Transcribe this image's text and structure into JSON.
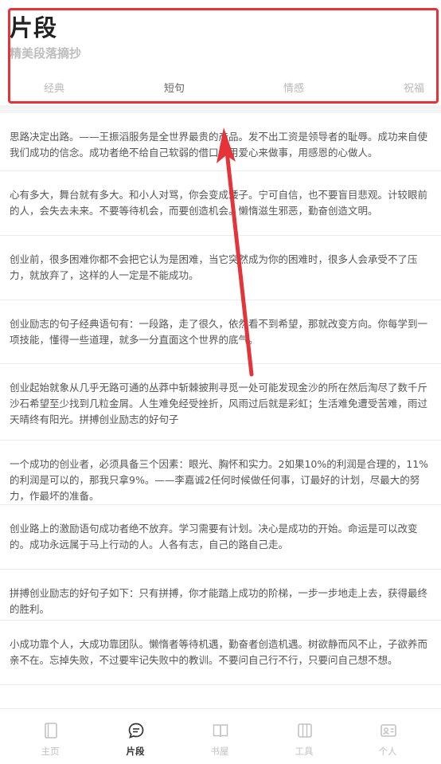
{
  "header": {
    "title": "片段",
    "subtitle": "精美段落摘抄",
    "tabs": [
      {
        "label": "经典"
      },
      {
        "label": "短句"
      },
      {
        "label": "情感"
      },
      {
        "label": "祝福"
      }
    ],
    "highlight_color": "#e5333a"
  },
  "list": {
    "items": [
      {
        "text": "思路决定出路。——王振滔服务是全世界最贵的产品。发不出工资是领导者的耻辱。成功来自使我们成功的信念。成功者绝不给自己软弱的借口。用爱心来做事，用感恩的心做人。"
      },
      {
        "text": "心有多大，舞台就有多大。和小人对骂，你会变成矮子。宁可自信，也不要盲目悲观。计较眼前的人，会失去未来。不要等待机会，而要创造机会。懒惰滋生邪恶，勤奋创造文明。"
      },
      {
        "text": "创业前，很多困难你都不会把它认为是困难，当它突然成为你的困难时，很多人会承受不了压力，就放弃了，这样的人一定是不能成功。"
      },
      {
        "text": "创业励志的句子经典语句有：一段路，走了很久，依然看不到希望，那就改变方向。你每学到一项技能，懂得一些道理，就多一分直面这个世界的底气。"
      },
      {
        "text": "创业起始就象从几乎无路可通的丛莽中斩棘披荆寻觅一处可能发现金沙的所在然后淘尽了数千斤沙石希望至少找到几粒金屑。人生难免经受挫折，风雨过后就是彩虹；生活难免遭受苦难，雨过天晴终有阳光。拼搏创业励志的好句子"
      },
      {
        "text": "一个成功的创业者，必须具备三个因素：眼光、胸怀和实力。2如果10%的利润是合理的，11%的利润是可以的，那我只拿9%。——李嘉诚2任何时候做任何事，订最好的计划，尽最大的努力，作最坏的准备。"
      },
      {
        "text": "创业路上的激励语句成功者绝不放弃。学习需要有计划。决心是成功的开始。命运是可以改变的。成功永远属于马上行动的人。人各有志，自己的路自己走。"
      },
      {
        "text": "拼搏创业励志的好句子如下：只有拼搏，你才能踏上成功的阶梯，一步一步地走上去，获得最终的胜利。"
      },
      {
        "text": "小成功靠个人，大成功靠团队。懒惰者等待机遇，勤奋者创造机遇。树欲静而风不止，子欲养而亲不在。忘掉失败，不过要牢记失败中的教训。不要问自己行不行，只要问自己想不想。"
      }
    ]
  },
  "nav": {
    "items": [
      {
        "label": "主页",
        "icon": "book-icon"
      },
      {
        "label": "片段",
        "icon": "chat-bubble-icon"
      },
      {
        "label": "书屋",
        "icon": "open-book-icon"
      },
      {
        "label": "工具",
        "icon": "toolbox-icon"
      },
      {
        "label": "个人",
        "icon": "id-card-icon"
      }
    ],
    "active_color": "#333333",
    "inactive_color": "#c2c2c2"
  },
  "annotation": {
    "arrow_color": "#e5333a"
  }
}
